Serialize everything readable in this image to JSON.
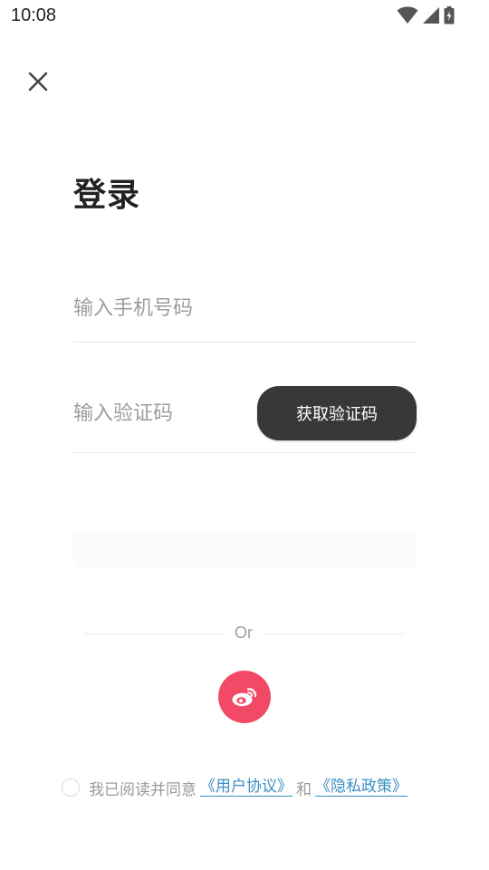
{
  "status_bar": {
    "time": "10:08"
  },
  "title": "登录",
  "phone": {
    "placeholder": "输入手机号码",
    "value": ""
  },
  "code": {
    "placeholder": "输入验证码",
    "value": "",
    "button_label": "获取验证码"
  },
  "divider": {
    "text": "Or"
  },
  "agreement": {
    "prefix": "我已阅读并同意",
    "user_agreement": "《用户协议》",
    "conjunction": "和",
    "privacy_policy": "《隐私政策》"
  },
  "colors": {
    "accent_dark": "#383838",
    "weibo": "#f24a66",
    "link": "#3a8ec2"
  },
  "icons": {
    "close": "close-icon",
    "weibo": "weibo-icon",
    "wifi": "wifi-icon",
    "signal": "signal-icon",
    "battery": "battery-icon"
  }
}
